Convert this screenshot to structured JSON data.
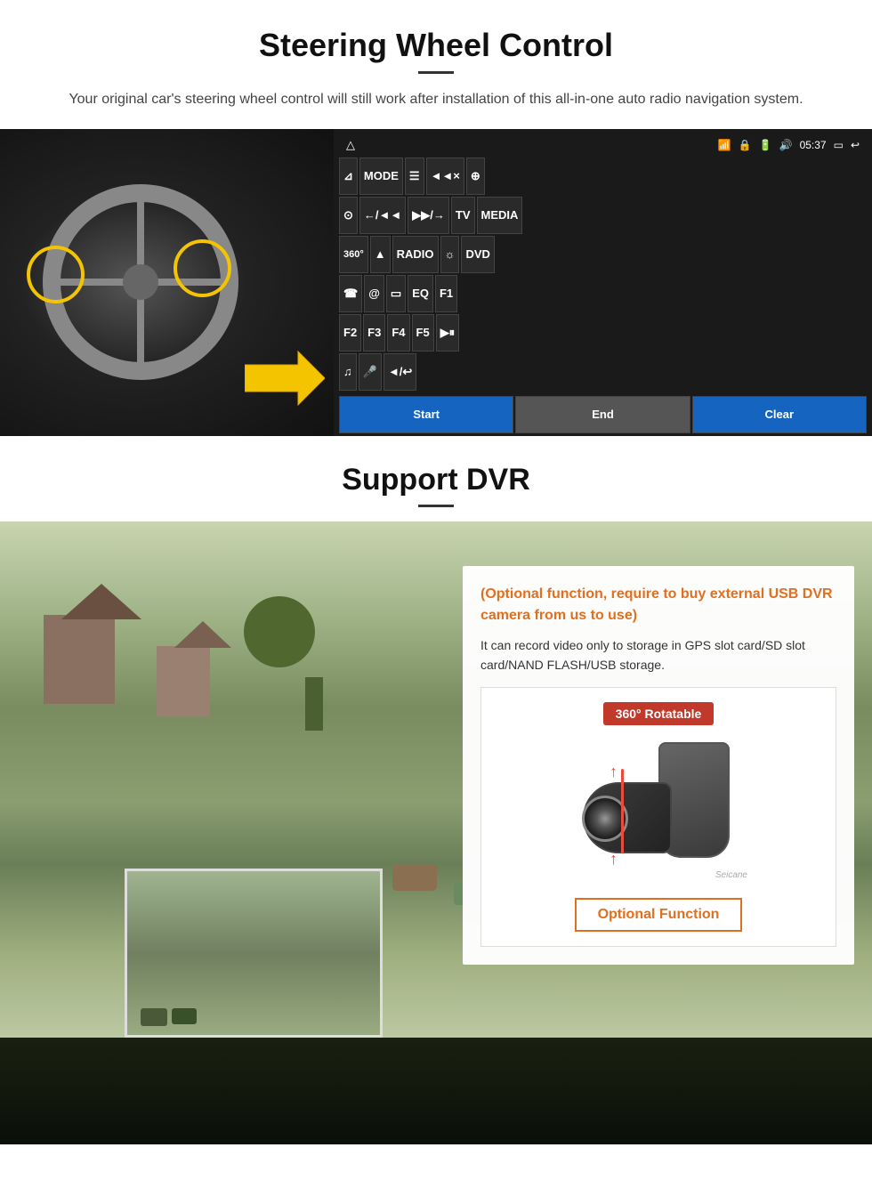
{
  "steering": {
    "title": "Steering Wheel Control",
    "description": "Your original car's steering wheel control will still work after installation of this all-in-one auto radio navigation system.",
    "topbar": {
      "time": "05:37",
      "icons": [
        "wifi",
        "lock",
        "battery",
        "volume"
      ]
    },
    "radio_buttons": [
      {
        "label": "⊿",
        "id": "nav"
      },
      {
        "label": "MODE",
        "id": "mode"
      },
      {
        "label": "≡",
        "id": "menu"
      },
      {
        "label": "◄◄×",
        "id": "vol-mute"
      },
      {
        "label": "⊕",
        "id": "apps"
      },
      {
        "label": "⊙",
        "id": "settings"
      },
      {
        "label": "←/◄◄",
        "id": "prev"
      },
      {
        "label": "▶▶/→",
        "id": "next"
      },
      {
        "label": "TV",
        "id": "tv"
      },
      {
        "label": "MEDIA",
        "id": "media"
      },
      {
        "label": "360°",
        "id": "camera360"
      },
      {
        "label": "▲",
        "id": "eject"
      },
      {
        "label": "RADIO",
        "id": "radio"
      },
      {
        "label": "☼",
        "id": "brightness"
      },
      {
        "label": "DVD",
        "id": "dvd"
      },
      {
        "label": "☎",
        "id": "phone"
      },
      {
        "label": "@",
        "id": "browser"
      },
      {
        "label": "▭",
        "id": "rect"
      },
      {
        "label": "EQ",
        "id": "eq"
      },
      {
        "label": "F1",
        "id": "f1"
      },
      {
        "label": "F2",
        "id": "f2"
      },
      {
        "label": "F3",
        "id": "f3"
      },
      {
        "label": "F4",
        "id": "f4"
      },
      {
        "label": "F5",
        "id": "f5"
      },
      {
        "label": "▶⏸",
        "id": "play-pause"
      },
      {
        "label": "♫",
        "id": "music"
      },
      {
        "label": "🎤",
        "id": "mic"
      },
      {
        "label": "◄/↩",
        "id": "back"
      }
    ],
    "buttons": {
      "start": "Start",
      "end": "End",
      "clear": "Clear"
    }
  },
  "dvr": {
    "title": "Support DVR",
    "optional_text": "(Optional function, require to buy external USB DVR camera from us to use)",
    "desc_text": "It can record video only to storage in GPS slot card/SD slot card/NAND FLASH/USB storage.",
    "badge": "360° Rotatable",
    "optional_function_label": "Optional Function"
  }
}
